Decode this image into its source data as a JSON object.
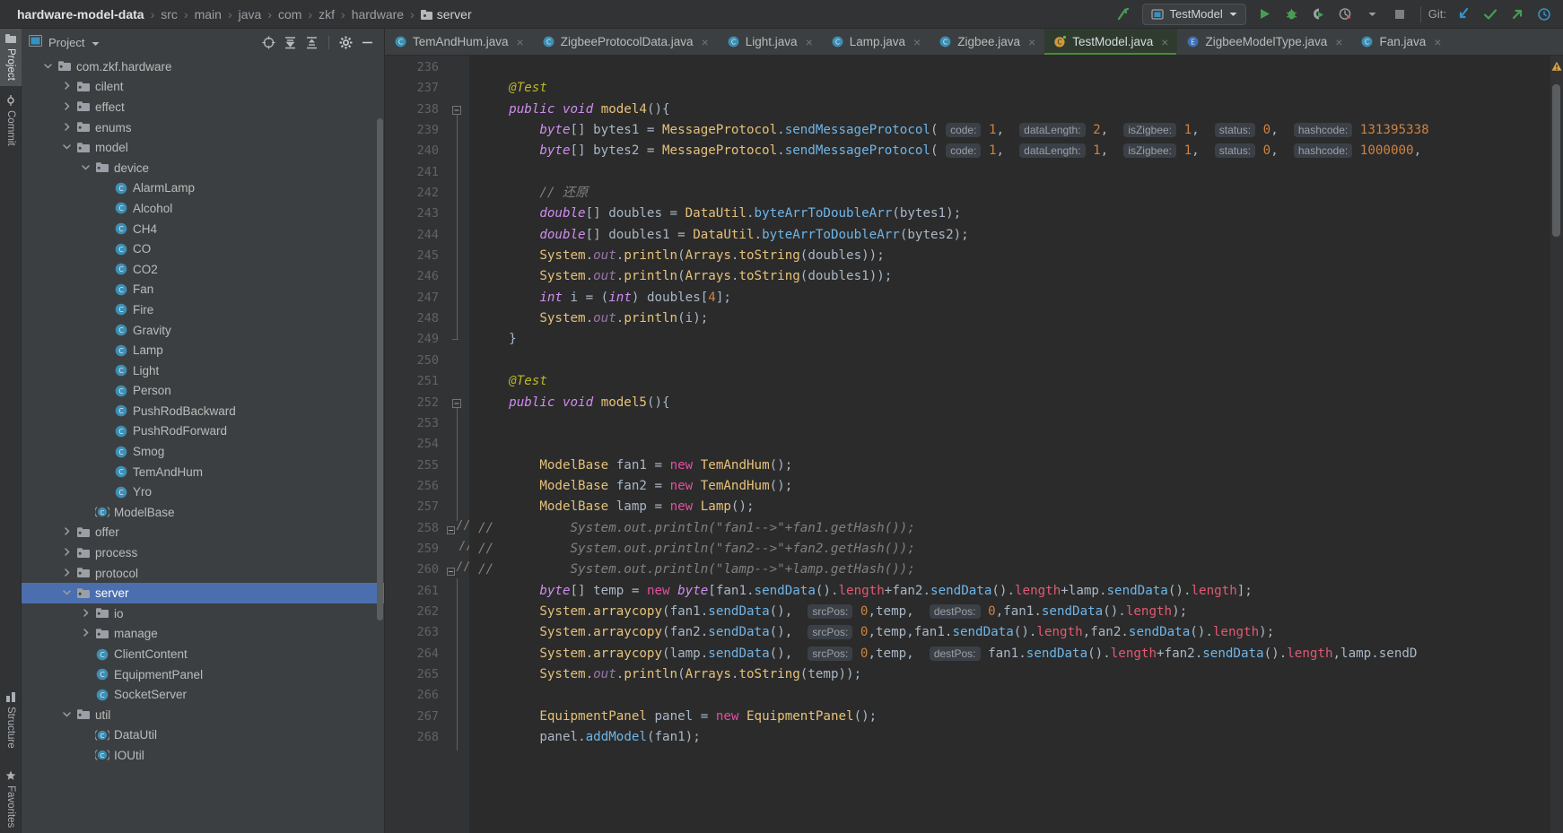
{
  "breadcrumb": {
    "items": [
      {
        "label": "hardware-model-data",
        "root": true
      },
      {
        "label": "src"
      },
      {
        "label": "main"
      },
      {
        "label": "java"
      },
      {
        "label": "com"
      },
      {
        "label": "zkf"
      },
      {
        "label": "hardware"
      },
      {
        "label": "server",
        "folder": true
      }
    ],
    "separator": "›"
  },
  "toolbar": {
    "build_icon": "build-hammer-icon",
    "run_config": "TestModel",
    "run_icon": "run-icon",
    "debug_icon": "debug-icon",
    "run_coverage_icon": "run-with-coverage-icon",
    "profile_icon": "profiler-icon",
    "stop_icon": "stop-icon",
    "git_label": "Git:",
    "git_update_icon": "update-project-icon",
    "git_commit_icon": "commit-icon",
    "git_push_icon": "push-icon",
    "accent_green": "#499c54",
    "accent_blue": "#3592c4"
  },
  "rail": {
    "top": [
      {
        "label": "Project",
        "icon": "project-icon",
        "active": true
      },
      {
        "label": "Commit",
        "icon": "commit-icon",
        "active": false
      }
    ],
    "bottom": [
      {
        "label": "Structure",
        "icon": "structure-icon"
      },
      {
        "label": "Favorites",
        "icon": "favorites-icon"
      }
    ]
  },
  "project_panel": {
    "title": "Project",
    "dropdown_icon": "chevron-down-icon",
    "tools": [
      {
        "name": "scroll-from-source-icon"
      },
      {
        "name": "expand-all-icon"
      },
      {
        "name": "collapse-all-icon"
      },
      {
        "name": "settings-gear-icon"
      },
      {
        "name": "hide-panel-icon"
      }
    ],
    "tree": [
      {
        "label": "com.zkf.hardware",
        "depth": 2,
        "type": "folder",
        "state": "expanded"
      },
      {
        "label": "cilent",
        "depth": 3,
        "type": "folder",
        "state": "collapsed"
      },
      {
        "label": "effect",
        "depth": 3,
        "type": "folder",
        "state": "collapsed"
      },
      {
        "label": "enums",
        "depth": 3,
        "type": "folder",
        "state": "collapsed"
      },
      {
        "label": "model",
        "depth": 3,
        "type": "folder",
        "state": "expanded"
      },
      {
        "label": "device",
        "depth": 4,
        "type": "folder",
        "state": "expanded"
      },
      {
        "label": "AlarmLamp",
        "depth": 5,
        "type": "class"
      },
      {
        "label": "Alcohol",
        "depth": 5,
        "type": "class"
      },
      {
        "label": "CH4",
        "depth": 5,
        "type": "class"
      },
      {
        "label": "CO",
        "depth": 5,
        "type": "class"
      },
      {
        "label": "CO2",
        "depth": 5,
        "type": "class"
      },
      {
        "label": "Fan",
        "depth": 5,
        "type": "class"
      },
      {
        "label": "Fire",
        "depth": 5,
        "type": "class"
      },
      {
        "label": "Gravity",
        "depth": 5,
        "type": "class"
      },
      {
        "label": "Lamp",
        "depth": 5,
        "type": "class"
      },
      {
        "label": "Light",
        "depth": 5,
        "type": "class"
      },
      {
        "label": "Person",
        "depth": 5,
        "type": "class"
      },
      {
        "label": "PushRodBackward",
        "depth": 5,
        "type": "class"
      },
      {
        "label": "PushRodForward",
        "depth": 5,
        "type": "class"
      },
      {
        "label": "Smog",
        "depth": 5,
        "type": "class"
      },
      {
        "label": "TemAndHum",
        "depth": 5,
        "type": "class"
      },
      {
        "label": "Yro",
        "depth": 5,
        "type": "class"
      },
      {
        "label": "ModelBase",
        "depth": 4,
        "type": "abstract-class"
      },
      {
        "label": "offer",
        "depth": 3,
        "type": "folder",
        "state": "collapsed"
      },
      {
        "label": "process",
        "depth": 3,
        "type": "folder",
        "state": "collapsed"
      },
      {
        "label": "protocol",
        "depth": 3,
        "type": "folder",
        "state": "collapsed"
      },
      {
        "label": "server",
        "depth": 3,
        "type": "folder",
        "state": "expanded",
        "selected": true
      },
      {
        "label": "io",
        "depth": 4,
        "type": "folder",
        "state": "collapsed"
      },
      {
        "label": "manage",
        "depth": 4,
        "type": "folder",
        "state": "collapsed"
      },
      {
        "label": "ClientContent",
        "depth": 4,
        "type": "class"
      },
      {
        "label": "EquipmentPanel",
        "depth": 4,
        "type": "class"
      },
      {
        "label": "SocketServer",
        "depth": 4,
        "type": "class"
      },
      {
        "label": "util",
        "depth": 3,
        "type": "folder",
        "state": "expanded"
      },
      {
        "label": "DataUtil",
        "depth": 4,
        "type": "abstract-class"
      },
      {
        "label": "IOUtil",
        "depth": 4,
        "type": "abstract-class"
      }
    ]
  },
  "editor_tabs": [
    {
      "label": "TemAndHum.java",
      "icon": "class-icon",
      "active": false
    },
    {
      "label": "ZigbeeProtocolData.java",
      "icon": "class-icon",
      "active": false
    },
    {
      "label": "Light.java",
      "icon": "class-icon",
      "active": false
    },
    {
      "label": "Lamp.java",
      "icon": "class-icon",
      "active": false
    },
    {
      "label": "Zigbee.java",
      "icon": "class-icon",
      "active": false
    },
    {
      "label": "TestModel.java",
      "icon": "test-class-icon",
      "active": true
    },
    {
      "label": "ZigbeeModelType.java",
      "icon": "enum-icon",
      "active": false
    },
    {
      "label": "Fan.java",
      "icon": "class-icon",
      "active": false
    }
  ],
  "editor": {
    "first_line": 236,
    "lines": [
      {
        "n": 236,
        "text": ""
      },
      {
        "n": 237,
        "text": "    @Test"
      },
      {
        "n": 238,
        "text": "    public void model4(){",
        "runmark": true,
        "fold": "start"
      },
      {
        "n": 239,
        "text": "        byte[] bytes1 = MessageProtocol.sendMessageProtocol( code: 1,  dataLength: 2,  isZigbee: 1,  status: 0,  hashcode: 131395338"
      },
      {
        "n": 240,
        "text": "        byte[] bytes2 = MessageProtocol.sendMessageProtocol( code: 1,  dataLength: 1,  isZigbee: 1,  status: 0,  hashcode: 1000000,"
      },
      {
        "n": 241,
        "text": ""
      },
      {
        "n": 242,
        "text": "        // 还原"
      },
      {
        "n": 243,
        "text": "        double[] doubles = DataUtil.byteArrToDoubleArr(bytes1);"
      },
      {
        "n": 244,
        "text": "        double[] doubles1 = DataUtil.byteArrToDoubleArr(bytes2);"
      },
      {
        "n": 245,
        "text": "        System.out.println(Arrays.toString(doubles));"
      },
      {
        "n": 246,
        "text": "        System.out.println(Arrays.toString(doubles1));"
      },
      {
        "n": 247,
        "text": "        int i = (int) doubles[4];"
      },
      {
        "n": 248,
        "text": "        System.out.println(i);"
      },
      {
        "n": 249,
        "text": "    }",
        "fold": "end"
      },
      {
        "n": 250,
        "text": ""
      },
      {
        "n": 251,
        "text": "    @Test"
      },
      {
        "n": 252,
        "text": "    public void model5(){",
        "runmark": true,
        "fold": "start"
      },
      {
        "n": 253,
        "text": ""
      },
      {
        "n": 254,
        "text": ""
      },
      {
        "n": 255,
        "text": "        ModelBase fan1 = new TemAndHum();"
      },
      {
        "n": 256,
        "text": "        ModelBase fan2 = new TemAndHum();"
      },
      {
        "n": 257,
        "text": "        ModelBase lamp = new Lamp();"
      },
      {
        "n": 258,
        "text": "//          System.out.println(\"fan1-->\"+fan1.getHash());",
        "comment_marker": "//"
      },
      {
        "n": 259,
        "text": "//          System.out.println(\"fan2-->\"+fan2.getHash());",
        "comment_marker": "//"
      },
      {
        "n": 260,
        "text": "//          System.out.println(\"lamp-->\"+lamp.getHash());",
        "comment_marker": "//"
      },
      {
        "n": 261,
        "text": "        byte[] temp = new byte[fan1.sendData().length+fan2.sendData().length+lamp.sendData().length];"
      },
      {
        "n": 262,
        "text": "        System.arraycopy(fan1.sendData(),  srcPos: 0,temp,  destPos: 0,fan1.sendData().length);"
      },
      {
        "n": 263,
        "text": "        System.arraycopy(fan2.sendData(),  srcPos: 0,temp,fan1.sendData().length,fan2.sendData().length);"
      },
      {
        "n": 264,
        "text": "        System.arraycopy(lamp.sendData(),  srcPos: 0,temp,  destPos: fan1.sendData().length+fan2.sendData().length,lamp.sendD"
      },
      {
        "n": 265,
        "text": "        System.out.println(Arrays.toString(temp));"
      },
      {
        "n": 266,
        "text": ""
      },
      {
        "n": 267,
        "text": "        EquipmentPanel panel = new EquipmentPanel();"
      },
      {
        "n": 268,
        "text": "        panel.addModel(fan1);"
      }
    ],
    "warning_icon": "warning-triangle-icon"
  }
}
